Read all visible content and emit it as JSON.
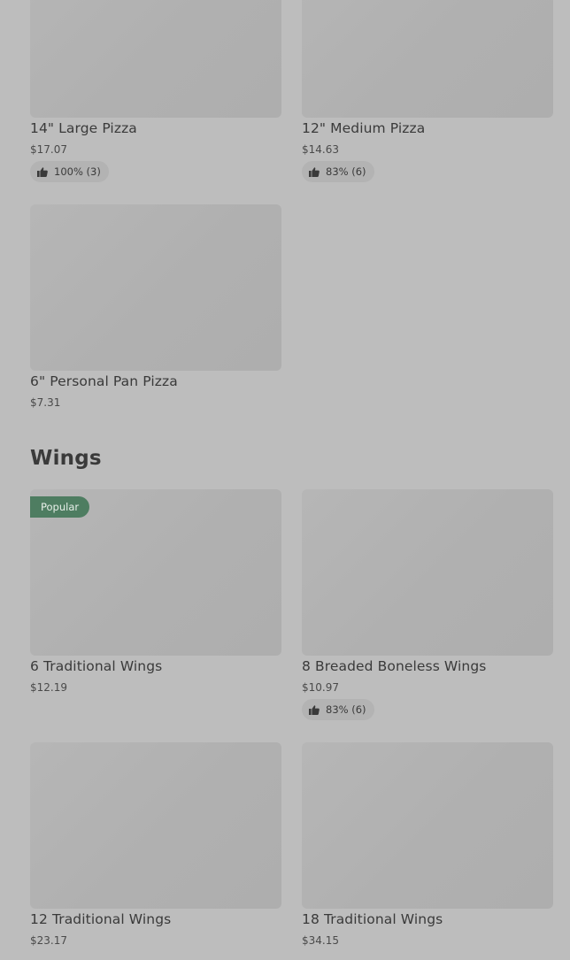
{
  "pizza_section": {
    "items": [
      {
        "name": "14\" Large Pizza",
        "price": "$17.07",
        "rating": "100% (3)"
      },
      {
        "name": "12\" Medium Pizza",
        "price": "$14.63",
        "rating": "83% (6)"
      },
      {
        "name": "6\" Personal Pan Pizza",
        "price": "$7.31"
      }
    ]
  },
  "wings_section": {
    "title": "Wings",
    "items": [
      {
        "name": "6 Traditional Wings",
        "price": "$12.19",
        "badge": "Popular"
      },
      {
        "name": "8 Breaded Boneless Wings",
        "price": "$10.97",
        "rating": "83% (6)"
      },
      {
        "name": "12 Traditional Wings",
        "price": "$23.17"
      },
      {
        "name": "18 Traditional Wings",
        "price": "$34.15"
      }
    ]
  },
  "icons": {
    "rating": "thumbs-up-icon"
  },
  "colors": {
    "background": "#bdbdbd",
    "badge": "#4e7d61",
    "text": "#3a3a3a"
  }
}
